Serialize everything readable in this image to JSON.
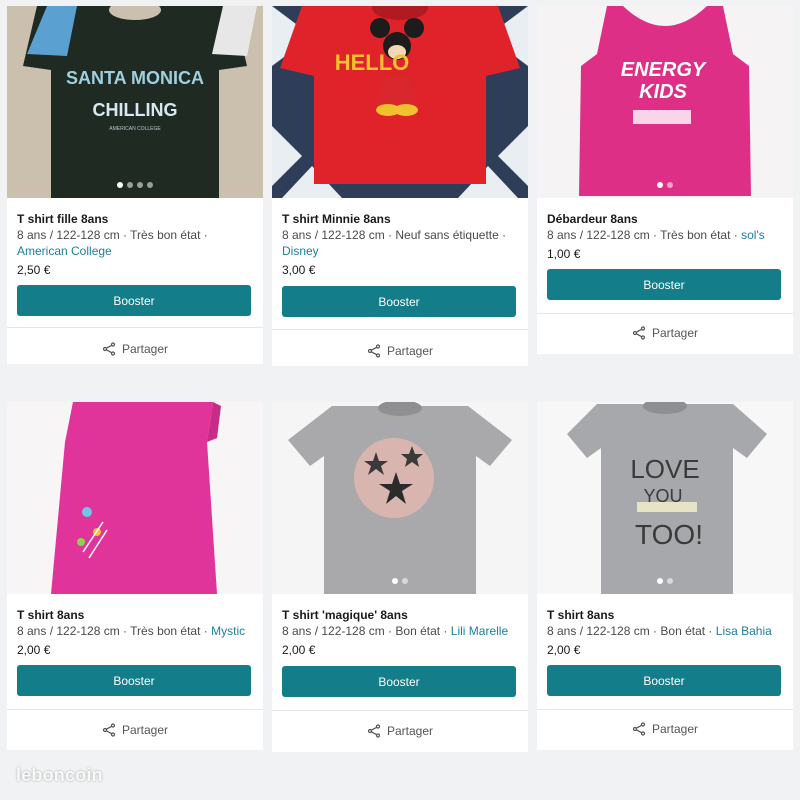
{
  "listings": [
    {
      "title": "T shirt fille 8ans",
      "meta": "8 ans / 122-128 cm · Très bon état ·",
      "brand": "American College",
      "price": "2,50 €",
      "booster_label": "Booster",
      "share_label": "Partager",
      "photo": {
        "text_lines": [
          "SANTA MONICA",
          "CHILLING",
          "AMERICAN COLLEGE"
        ]
      }
    },
    {
      "title": "T shirt Minnie 8ans",
      "meta": "8 ans / 122-128 cm · Neuf sans étiquette ·",
      "brand": "Disney",
      "price": "3,00 €",
      "booster_label": "Booster",
      "share_label": "Partager",
      "photo": {
        "text_lines": [
          "HELLO"
        ]
      }
    },
    {
      "title": "Débardeur  8ans",
      "meta": "8 ans / 122-128 cm · Très bon état ·",
      "brand": "sol's",
      "price": "1,00 €",
      "booster_label": "Booster",
      "share_label": "Partager",
      "photo": {
        "text_lines": [
          "ENERGY",
          "KIDS"
        ]
      }
    },
    {
      "title": "T shirt 8ans",
      "meta": "8 ans / 122-128 cm · Très bon état ·",
      "brand": "Mystic",
      "price": "2,00 €",
      "booster_label": "Booster",
      "share_label": "Partager",
      "photo": {
        "text_lines": []
      }
    },
    {
      "title": "T shirt 'magique' 8ans",
      "meta": "8 ans / 122-128 cm · Bon état ·",
      "brand": "Lili Marelle",
      "price": "2,00 €",
      "booster_label": "Booster",
      "share_label": "Partager",
      "photo": {
        "text_lines": []
      }
    },
    {
      "title": "T shirt 8ans",
      "meta": "8 ans / 122-128 cm · Bon état ·",
      "brand": "Lisa Bahia",
      "price": "2,00 €",
      "booster_label": "Booster",
      "share_label": "Partager",
      "photo": {
        "text_lines": [
          "LOVE",
          "YOU",
          "TOO!"
        ]
      }
    }
  ],
  "watermark": "leboncoin",
  "colors": {
    "booster": "#137d8a",
    "brand_link": "#1a7fa0",
    "background": "#f1f2f3"
  },
  "icons": {
    "share": "share-icon"
  }
}
